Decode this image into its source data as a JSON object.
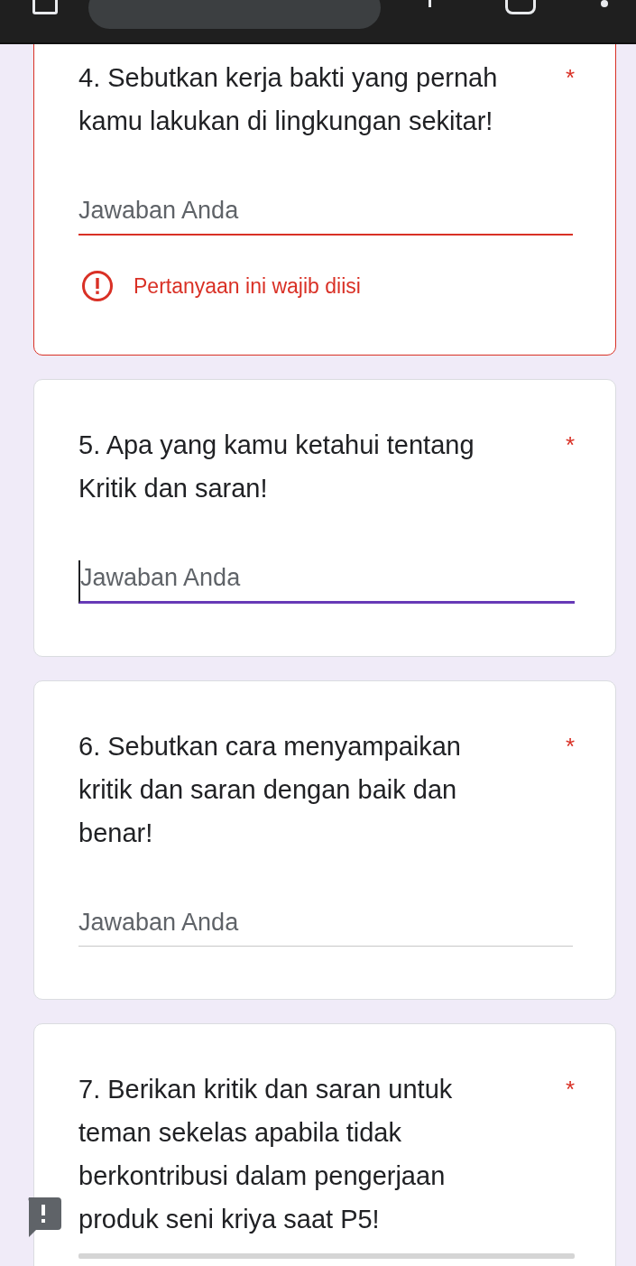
{
  "questions": [
    {
      "text": "4. Sebutkan kerja bakti yang pernah kamu lakukan di lingkungan sekitar!",
      "required_mark": "*",
      "field": {
        "placeholder": "Jawaban Anda",
        "focused": false
      },
      "error": "Pertanyaan ini wajib diisi"
    },
    {
      "text": "5. Apa yang kamu ketahui tentang Kritik dan saran!",
      "required_mark": "*",
      "field": {
        "placeholder": "Jawaban Anda",
        "focused": true
      }
    },
    {
      "text": "6. Sebutkan cara menyampaikan kritik dan saran dengan baik dan benar!",
      "required_mark": "*",
      "field": {
        "placeholder": "Jawaban Anda",
        "focused": false
      }
    },
    {
      "text": "7. Berikan kritik dan saran untuk teman sekelas apabila tidak berkontribusi dalam pengerjaan produk seni kriya saat P5!",
      "required_mark": "*"
    }
  ]
}
